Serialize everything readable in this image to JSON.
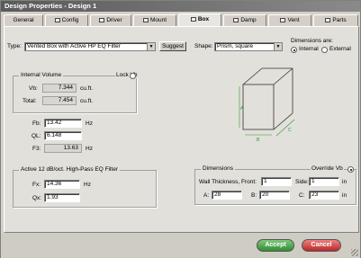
{
  "window": {
    "title": "Design Properties - Design 1"
  },
  "tabs": [
    {
      "label": "General",
      "icon": "none"
    },
    {
      "label": "Config",
      "icon": "config-icon"
    },
    {
      "label": "Driver",
      "icon": "driver-icon"
    },
    {
      "label": "Mount",
      "icon": "mount-icon"
    },
    {
      "label": "Box",
      "icon": "box-icon",
      "active": true
    },
    {
      "label": "Damp",
      "icon": "damp-icon"
    },
    {
      "label": "Vent",
      "icon": "vent-icon"
    },
    {
      "label": "Parts",
      "icon": "parts-icon"
    }
  ],
  "type": {
    "label": "Type:",
    "value": "Vented Box with Active HP EQ Filter",
    "suggest_label": "Suggest"
  },
  "shape": {
    "label": "Shape:",
    "value": "Prism, square"
  },
  "dimensions_are": {
    "label": "Dimensions are:",
    "internal_label": "Internal",
    "external_label": "External",
    "selected": "Internal"
  },
  "internal_volume": {
    "title": "Internal Volume",
    "lock_label": "Lock Vb",
    "vb_label": "Vb:",
    "vb_value": "7.344",
    "total_label": "Total:",
    "total_value": "7.454",
    "unit": "cu.ft."
  },
  "tuning": {
    "fb_label": "Fb:",
    "fb_value": "13.42",
    "fb_unit": "Hz",
    "ql_label": "QL:",
    "ql_value": "6.148",
    "f3_label": "F3:",
    "f3_value": "13.63",
    "f3_unit": "Hz"
  },
  "filter": {
    "title": "Active 12 dB/oct. High-Pass EQ Filter",
    "fx_label": "Fx:",
    "fx_value": "14.36",
    "fx_unit": "Hz",
    "qx_label": "Qx:",
    "qx_value": "1.93"
  },
  "dimensions": {
    "title": "Dimensions",
    "override_label": "Override Vb",
    "wall_label": "Wall Thickness, Front:",
    "wall_front_value": "1",
    "side_label": "Side:",
    "side_value": "1",
    "unit": "in",
    "a_label": "A:",
    "a_value": "28",
    "b_label": "B:",
    "b_value": "20",
    "c_label": "C:",
    "c_value": "23"
  },
  "diagram": {
    "a": "A",
    "b": "B",
    "c": "C"
  },
  "footer": {
    "accept_label": "Accept",
    "cancel_label": "Cancel"
  },
  "colors": {
    "accept": "#2f8f2f",
    "cancel": "#b82828",
    "diagram_dim": "#2e9a2e"
  }
}
